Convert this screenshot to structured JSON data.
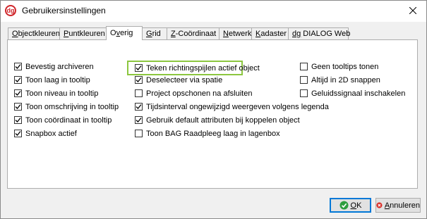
{
  "window": {
    "title": "Gebruikersinstellingen",
    "app_icon_text": "dg"
  },
  "tabs": [
    {
      "label": "Objectkleuren",
      "key": "O",
      "rest": "bjectkleuren",
      "active": false
    },
    {
      "label": "Puntkleuren",
      "key": "P",
      "rest": "untkleuren",
      "active": false
    },
    {
      "label": "Overig",
      "key": "v",
      "pre": "O",
      "rest": "erig",
      "active": true
    },
    {
      "label": "Grid",
      "key": "G",
      "rest": "rid",
      "active": false
    },
    {
      "label": "Z-Coördinaat",
      "key": "Z",
      "rest": "-Coördinaat",
      "active": false
    },
    {
      "label": "Netwerk",
      "key": "N",
      "rest": "etwerk",
      "active": false
    },
    {
      "label": "Kadaster",
      "key": "K",
      "rest": "adaster",
      "active": false
    },
    {
      "label": "dg DIALOG Web",
      "key": "dg",
      "rest": " DIALOG Web",
      "active": false
    }
  ],
  "options": {
    "col1": [
      {
        "label": "Bevestig archiveren",
        "checked": true
      },
      {
        "label": "Toon laag in tooltip",
        "checked": true
      },
      {
        "label": "Toon niveau in tooltip",
        "checked": true
      },
      {
        "label": "Toon omschrijving in tooltip",
        "checked": true
      },
      {
        "label": "Toon coördinaat in tooltip",
        "checked": true
      },
      {
        "label": "Snapbox actief",
        "checked": true
      }
    ],
    "col2": [
      {
        "label": "Teken richtingspijlen actief object",
        "checked": true
      },
      {
        "label": "Deselecteer via spatie",
        "checked": true
      },
      {
        "label": "Project opschonen na afsluiten",
        "checked": false
      },
      {
        "label": "Tijdsinterval ongewijzigd weergeven volgens legenda",
        "checked": true
      },
      {
        "label": "Gebruik default attributen bij koppelen object",
        "checked": true
      },
      {
        "label": "Toon BAG Raadpleeg laag in lagenbox",
        "checked": false
      }
    ],
    "col3": [
      {
        "label": "Geen tooltips tonen",
        "checked": false
      },
      {
        "label": "Altijd in 2D snappen",
        "checked": false
      },
      {
        "label": "Geluidssignaal inschakelen",
        "checked": false
      }
    ]
  },
  "buttons": {
    "ok_label": "OK",
    "ok_key": "O",
    "ok_rest": "K",
    "cancel_label": "Annuleren",
    "cancel_key": "A",
    "cancel_rest": "nnuleren"
  },
  "colors": {
    "focus_border": "#8cc63f",
    "default_button_border": "#0078d7",
    "ok_icon": "#2e9e3e",
    "cancel_icon": "#d9312b"
  }
}
